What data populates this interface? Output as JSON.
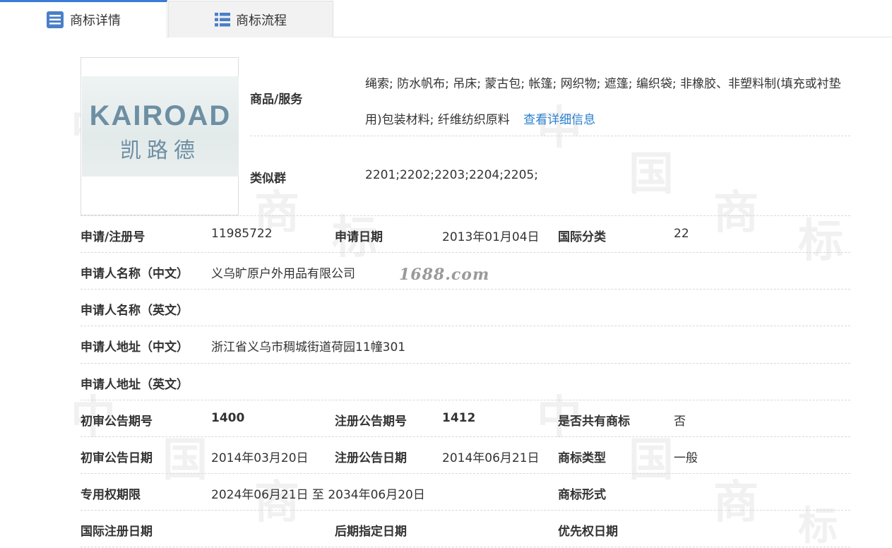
{
  "tabs": [
    {
      "label": "商标详情",
      "icon": "list-detail-icon",
      "active": true
    },
    {
      "label": "商标流程",
      "icon": "list-process-icon",
      "active": false
    }
  ],
  "logo": {
    "text_en": "KAIROAD",
    "text_cn": "凯路德"
  },
  "goods": {
    "label": "商品/服务",
    "value": "绳索; 防水帆布; 吊床; 蒙古包; 帐篷; 网织物; 遮篷; 编织袋; 非橡胶、非塑料制(填充或衬垫用)包装材料; 纤维纺织原料",
    "link": "查看详细信息"
  },
  "similar_group": {
    "label": "类似群",
    "value": "2201;2202;2203;2204;2205;"
  },
  "rows": {
    "reg_no": {
      "label": "申请/注册号",
      "value": "11985722"
    },
    "apply_date": {
      "label": "申请日期",
      "value": "2013年01月04日"
    },
    "intl_class": {
      "label": "国际分类",
      "value": "22"
    },
    "applicant_cn": {
      "label": "申请人名称（中文）",
      "value": "义乌旷原户外用品有限公司"
    },
    "applicant_en": {
      "label": "申请人名称（英文）",
      "value": ""
    },
    "address_cn": {
      "label": "申请人地址（中文）",
      "value": "浙江省义乌市稠城街道荷园11幢301"
    },
    "address_en": {
      "label": "申请人地址（英文）",
      "value": ""
    },
    "prelim_no": {
      "label": "初审公告期号",
      "value": "1400"
    },
    "reg_pub_no": {
      "label": "注册公告期号",
      "value": "1412"
    },
    "shared": {
      "label": "是否共有商标",
      "value": "否"
    },
    "prelim_date": {
      "label": "初审公告日期",
      "value": "2014年03月20日"
    },
    "reg_pub_date": {
      "label": "注册公告日期",
      "value": "2014年06月21日"
    },
    "tm_type": {
      "label": "商标类型",
      "value": "一般"
    },
    "exclusive_period": {
      "label": "专用权期限",
      "value": "2024年06月21日 至 2034年06月20日"
    },
    "tm_form": {
      "label": "商标形式",
      "value": ""
    },
    "intl_reg_date": {
      "label": "国际注册日期",
      "value": ""
    },
    "later_date": {
      "label": "后期指定日期",
      "value": ""
    },
    "priority_date": {
      "label": "优先权日期",
      "value": ""
    }
  },
  "watermark": {
    "site": "1688.com",
    "chars": [
      "中",
      "国",
      "商",
      "标"
    ]
  },
  "colors": {
    "accent": "#3a7bd5",
    "link": "#2a7fd1"
  }
}
